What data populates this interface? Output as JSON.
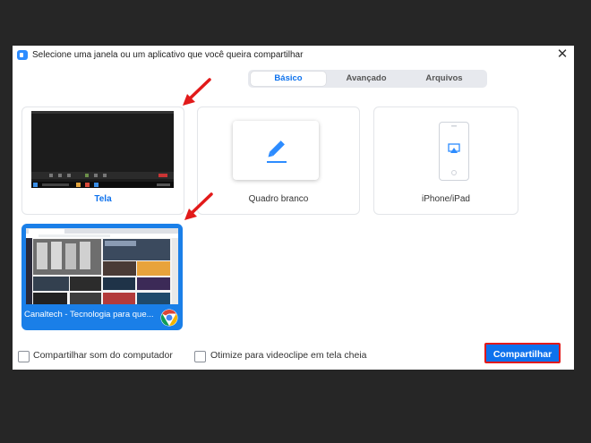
{
  "dialog": {
    "title": "Selecione uma janela ou um aplicativo que você queira compartilhar",
    "close_icon": "close-icon"
  },
  "tabs": [
    {
      "label": "Básico",
      "active": true
    },
    {
      "label": "Avançado",
      "active": false
    },
    {
      "label": "Arquivos",
      "active": false
    }
  ],
  "tiles": {
    "screen": {
      "label": "Tela",
      "selected": false
    },
    "whiteboard": {
      "label": "Quadro branco",
      "icon": "pen-icon"
    },
    "iphone": {
      "label": "iPhone/iPad",
      "icon": "airplay-phone-icon"
    },
    "browser_window": {
      "label": "Canaltech - Tecnologia para que...",
      "icon": "chrome-icon",
      "selected": true
    }
  },
  "options": {
    "share_sound_label": "Compartilhar som do computador",
    "share_sound_checked": false,
    "optimize_video_label": "Otimize para videoclipe em tela cheia",
    "optimize_video_checked": false
  },
  "actions": {
    "share_label": "Compartilhar"
  },
  "colors": {
    "accent": "#0e72ed",
    "highlight": "#e21a1a",
    "background": "#262626"
  }
}
